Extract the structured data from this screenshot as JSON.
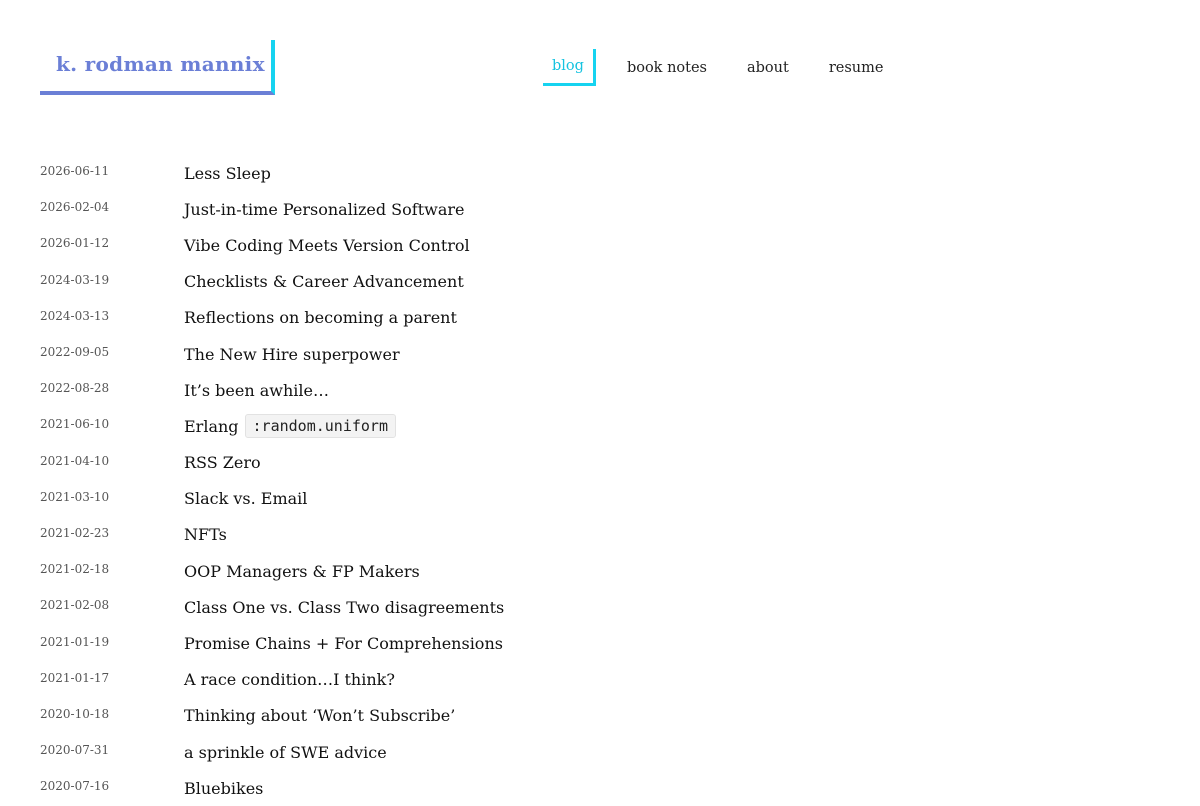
{
  "site": {
    "title": "k. rodman mannix"
  },
  "nav": {
    "items": [
      {
        "label": "blog"
      },
      {
        "label": "book notes"
      },
      {
        "label": "about"
      },
      {
        "label": "resume"
      }
    ],
    "active": "blog"
  },
  "posts": [
    {
      "date": "2026-06-11",
      "title": "Less Sleep"
    },
    {
      "date": "2026-02-04",
      "title": "Just-in-time Personalized Software"
    },
    {
      "date": "2026-01-12",
      "title": "Vibe Coding Meets Version Control"
    },
    {
      "date": "2024-03-19",
      "title": "Checklists & Career Advancement"
    },
    {
      "date": "2024-03-13",
      "title": "Reflections on becoming a parent"
    },
    {
      "date": "2022-09-05",
      "title": "The New Hire superpower"
    },
    {
      "date": "2022-08-28",
      "title": "It’s been awhile…"
    },
    {
      "date": "2021-06-10",
      "title": "Erlang",
      "code": ":random.uniform"
    },
    {
      "date": "2021-04-10",
      "title": "RSS Zero"
    },
    {
      "date": "2021-03-10",
      "title": "Slack vs. Email"
    },
    {
      "date": "2021-02-23",
      "title": "NFTs"
    },
    {
      "date": "2021-02-18",
      "title": "OOP Managers & FP Makers"
    },
    {
      "date": "2021-02-08",
      "title": "Class One vs. Class Two disagreements"
    },
    {
      "date": "2021-01-19",
      "title": "Promise Chains + For Comprehensions"
    },
    {
      "date": "2021-01-17",
      "title": "A race condition…I think?"
    },
    {
      "date": "2020-10-18",
      "title": "Thinking about ‘Won’t Subscribe’"
    },
    {
      "date": "2020-07-31",
      "title": "a sprinkle of SWE advice"
    },
    {
      "date": "2020-07-16",
      "title": "Bluebikes"
    }
  ],
  "colors": {
    "accent_cyan": "#16d3f0",
    "accent_blue": "#6b7fd6",
    "accent_pink": "#f3d0ea"
  }
}
